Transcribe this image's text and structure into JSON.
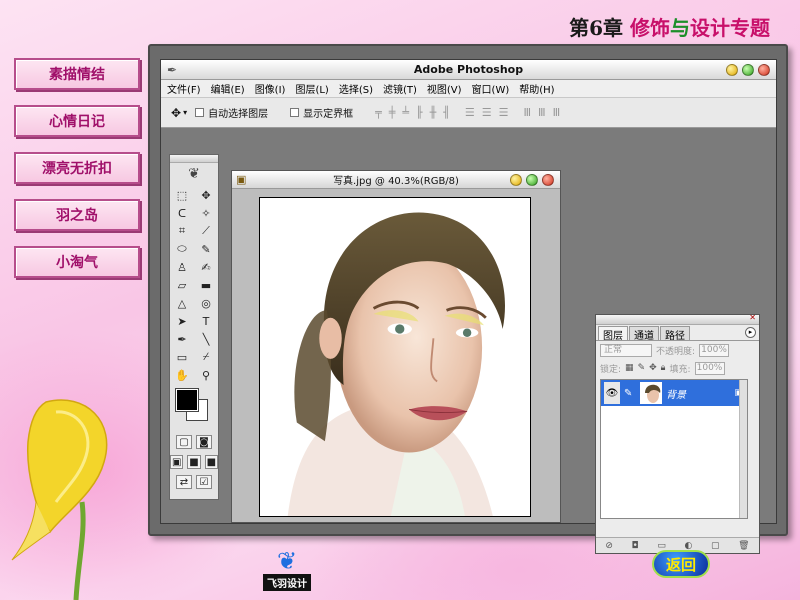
{
  "header": {
    "title_part1": "第6章 ",
    "title_part2": "修饰",
    "title_part3": "与",
    "title_part4": "设计专题"
  },
  "nav": {
    "items": [
      {
        "label": "素描情结"
      },
      {
        "label": "心情日记"
      },
      {
        "label": "漂亮无折扣"
      },
      {
        "label": "羽之岛"
      },
      {
        "label": "小淘气"
      }
    ]
  },
  "photoshop": {
    "app_title": "Adobe Photoshop",
    "menu": [
      {
        "label": "文件(F)"
      },
      {
        "label": "编辑(E)"
      },
      {
        "label": "图像(I)"
      },
      {
        "label": "图层(L)"
      },
      {
        "label": "选择(S)"
      },
      {
        "label": "滤镜(T)"
      },
      {
        "label": "视图(V)"
      },
      {
        "label": "窗口(W)"
      },
      {
        "label": "帮助(H)"
      }
    ],
    "options": {
      "auto_select_label": "自动选择图层",
      "show_bounds_label": "显示定界框"
    },
    "document": {
      "title": "写真.jpg @ 40.3%(RGB/8)"
    },
    "layers_panel": {
      "tabs": [
        {
          "label": "图层"
        },
        {
          "label": "通道"
        },
        {
          "label": "路径"
        }
      ],
      "blend_mode": "正常",
      "opacity_label": "不透明度:",
      "opacity_value": "100%",
      "lock_label": "锁定:",
      "fill_label": "填充:",
      "fill_value": "100%",
      "layer_name": "背景"
    }
  },
  "footer": {
    "logo_text": "飞羽设计",
    "back_label": "返回"
  },
  "colors": {
    "nav_text": "#a0106a",
    "layer_selected": "#2f6fdc",
    "back_text": "#ffea00"
  }
}
